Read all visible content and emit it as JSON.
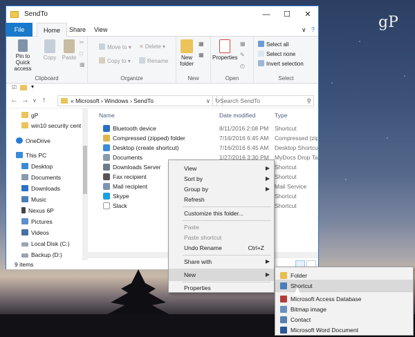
{
  "window": {
    "title": "SendTo"
  },
  "logo": {
    "text": "gP"
  },
  "ribbon": {
    "tabs": [
      "File",
      "Home",
      "Share",
      "View"
    ],
    "clipboard": {
      "pin": "Pin to Quick access",
      "copy": "Copy",
      "paste": "Paste",
      "label": "Clipboard"
    },
    "organize": {
      "move_to": "Move to",
      "copy_to": "Copy to",
      "delete": "Delete",
      "rename": "Rename",
      "label": "Organize"
    },
    "new": {
      "new_folder": "New folder",
      "label": "New"
    },
    "open": {
      "properties": "Properties",
      "label": "Open"
    },
    "select": {
      "select_all": "Select all",
      "select_none": "Select none",
      "invert": "Invert selection",
      "label": "Select"
    }
  },
  "address": {
    "path": "« Microsoft › Windows › SendTo",
    "search_placeholder": "Search SendTo"
  },
  "nav": {
    "items": [
      {
        "label": "gP",
        "icon": "pinned-folder-icon"
      },
      {
        "label": "win10 security cent",
        "icon": "pinned-folder-icon"
      },
      {
        "label": "OneDrive",
        "icon": "onedrive-icon"
      },
      {
        "label": "This PC",
        "icon": "computer-icon"
      },
      {
        "label": "Desktop",
        "icon": "desktop-icon"
      },
      {
        "label": "Documents",
        "icon": "documents-icon"
      },
      {
        "label": "Downloads",
        "icon": "downloads-icon"
      },
      {
        "label": "Music",
        "icon": "music-icon"
      },
      {
        "label": "Nexus 6P",
        "icon": "phone-icon"
      },
      {
        "label": "Pictures",
        "icon": "pictures-icon"
      },
      {
        "label": "Videos",
        "icon": "videos-icon"
      },
      {
        "label": "Local Disk (C:)",
        "icon": "disk-icon"
      },
      {
        "label": "Backup (D:)",
        "icon": "disk-icon"
      }
    ]
  },
  "columns": {
    "name": "Name",
    "date": "Date modified",
    "type": "Type"
  },
  "files": [
    {
      "name": "Bluetooth device",
      "date": "8/11/2016 2:08 PM",
      "type": "Shortcut",
      "icon": "bluetooth-icon",
      "color": "#2d6fc7"
    },
    {
      "name": "Compressed (zipped) folder",
      "date": "7/16/2016 6:45 AM",
      "type": "Compressed (zipp",
      "icon": "zip-folder-icon",
      "color": "#e2b54a"
    },
    {
      "name": "Desktop (create shortcut)",
      "date": "7/16/2016 6:45 AM",
      "type": "Desktop Shortcut",
      "icon": "desktop-icon",
      "color": "#3a8ad8"
    },
    {
      "name": "Documents",
      "date": "1/27/2016 3:30 PM",
      "type": "MyDocs Drop Tar",
      "icon": "documents-icon",
      "color": "#8a9bb0"
    },
    {
      "name": "Downloads Server",
      "date": "",
      "type": "Shortcut",
      "icon": "server-icon",
      "color": "#6b7a8c"
    },
    {
      "name": "Fax recipient",
      "date": "",
      "type": "Shortcut",
      "icon": "fax-icon",
      "color": "#555"
    },
    {
      "name": "Mail recipient",
      "date": "",
      "type": "Mail Service",
      "icon": "mail-icon",
      "color": "#7c93b3"
    },
    {
      "name": "Skype",
      "date": "",
      "type": "Shortcut",
      "icon": "skype-icon",
      "color": "#1ba0e1"
    },
    {
      "name": "Slack",
      "date": "",
      "type": "Shortcut",
      "icon": "slack-icon",
      "color": "#fff"
    }
  ],
  "status": {
    "count": "9 items"
  },
  "context_menu": {
    "view": "View",
    "sort_by": "Sort by",
    "group_by": "Group by",
    "refresh": "Refresh",
    "customize": "Customize this folder...",
    "paste": "Paste",
    "paste_shortcut": "Paste shortcut",
    "undo_rename": "Undo Rename",
    "undo_shortcut": "Ctrl+Z",
    "share_with": "Share with",
    "new": "New",
    "properties": "Properties"
  },
  "submenu": [
    {
      "label": "Folder",
      "icon": "folder-icon",
      "color": "#e8be4f"
    },
    {
      "label": "Shortcut",
      "icon": "shortcut-icon",
      "color": "#4a7fbd"
    },
    {
      "label": "Microsoft Access Database",
      "icon": "access-icon",
      "color": "#b33b3b"
    },
    {
      "label": "Bitmap image",
      "icon": "bitmap-icon",
      "color": "#6a8fc0"
    },
    {
      "label": "Contact",
      "icon": "contact-icon",
      "color": "#5580b0"
    },
    {
      "label": "Microsoft Word Document",
      "icon": "word-icon",
      "color": "#2b5797"
    }
  ]
}
